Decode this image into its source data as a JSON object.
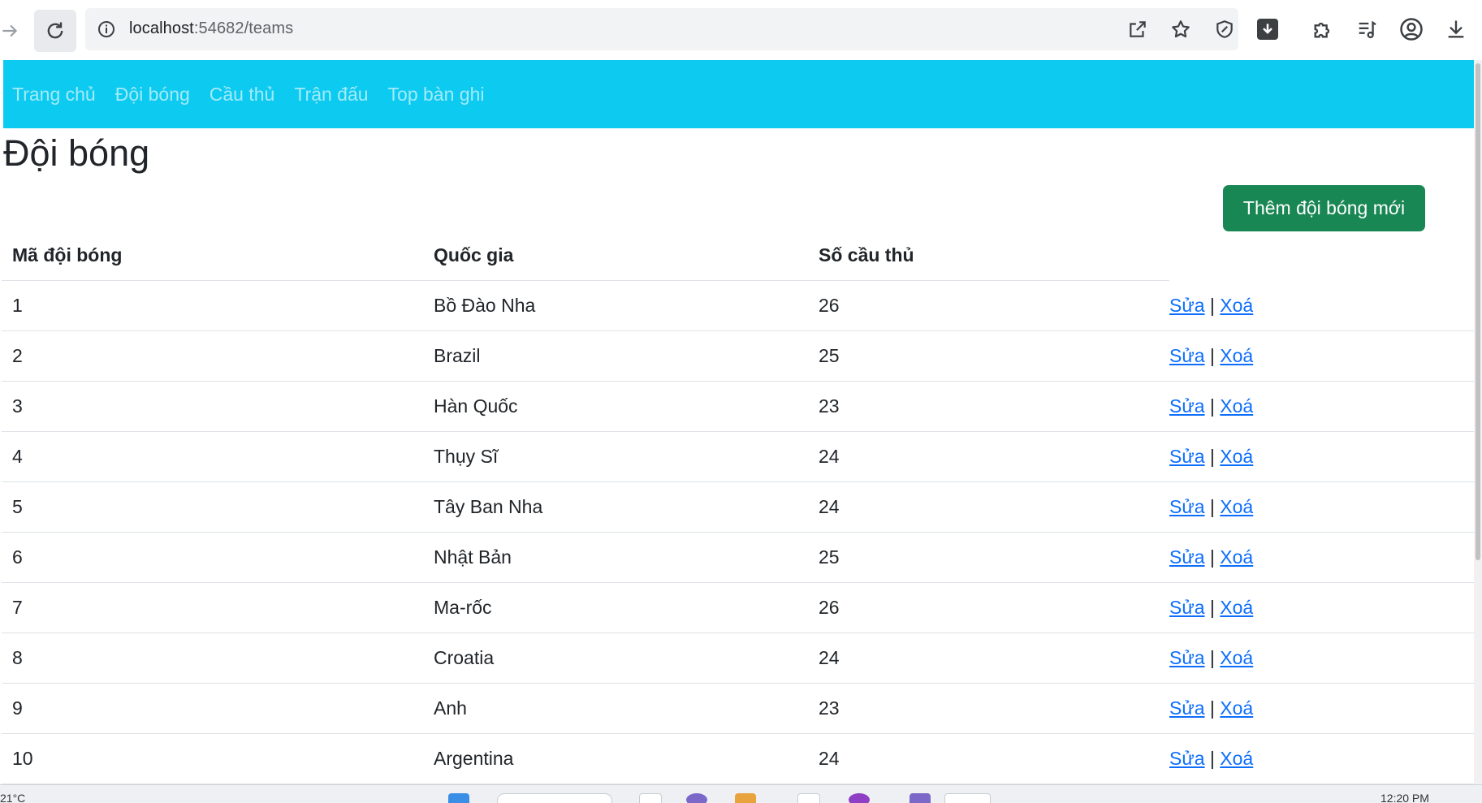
{
  "browser": {
    "url_host": "localhost",
    "url_path": ":54682/teams",
    "icons": [
      "back-arrow-icon",
      "reload-icon",
      "site-info-icon",
      "share-icon",
      "bookmark-star-icon",
      "shield-icon",
      "download-badge-icon",
      "extensions-puzzle-icon",
      "reading-list-icon",
      "profile-icon",
      "download-icon"
    ]
  },
  "navbar": {
    "items": [
      {
        "label": "Trang chủ"
      },
      {
        "label": "Đội bóng"
      },
      {
        "label": "Cầu thủ"
      },
      {
        "label": "Trận đấu"
      },
      {
        "label": "Top bàn ghi"
      }
    ],
    "bg_color": "#0dcaf0"
  },
  "page": {
    "title": "Đội bóng",
    "add_button_label": "Thêm đội bóng mới",
    "add_button_color": "#198754"
  },
  "table": {
    "headers": [
      "Mã đội bóng",
      "Quốc gia",
      "Số cầu thủ"
    ],
    "edit_label": "Sửa",
    "separator": "|",
    "delete_label": "Xoá",
    "rows": [
      {
        "id": "1",
        "country": "Bồ Đào Nha",
        "players": "26"
      },
      {
        "id": "2",
        "country": "Brazil",
        "players": "25"
      },
      {
        "id": "3",
        "country": "Hàn Quốc",
        "players": "23"
      },
      {
        "id": "4",
        "country": "Thụy Sĩ",
        "players": "24"
      },
      {
        "id": "5",
        "country": "Tây Ban Nha",
        "players": "24"
      },
      {
        "id": "6",
        "country": "Nhật Bản",
        "players": "25"
      },
      {
        "id": "7",
        "country": "Ma-rốc",
        "players": "26"
      },
      {
        "id": "8",
        "country": "Croatia",
        "players": "24"
      },
      {
        "id": "9",
        "country": "Anh",
        "players": "23"
      },
      {
        "id": "10",
        "country": "Argentina",
        "players": "24"
      }
    ]
  },
  "taskbar": {
    "temperature": "21°C",
    "clock": "12:20 PM"
  }
}
